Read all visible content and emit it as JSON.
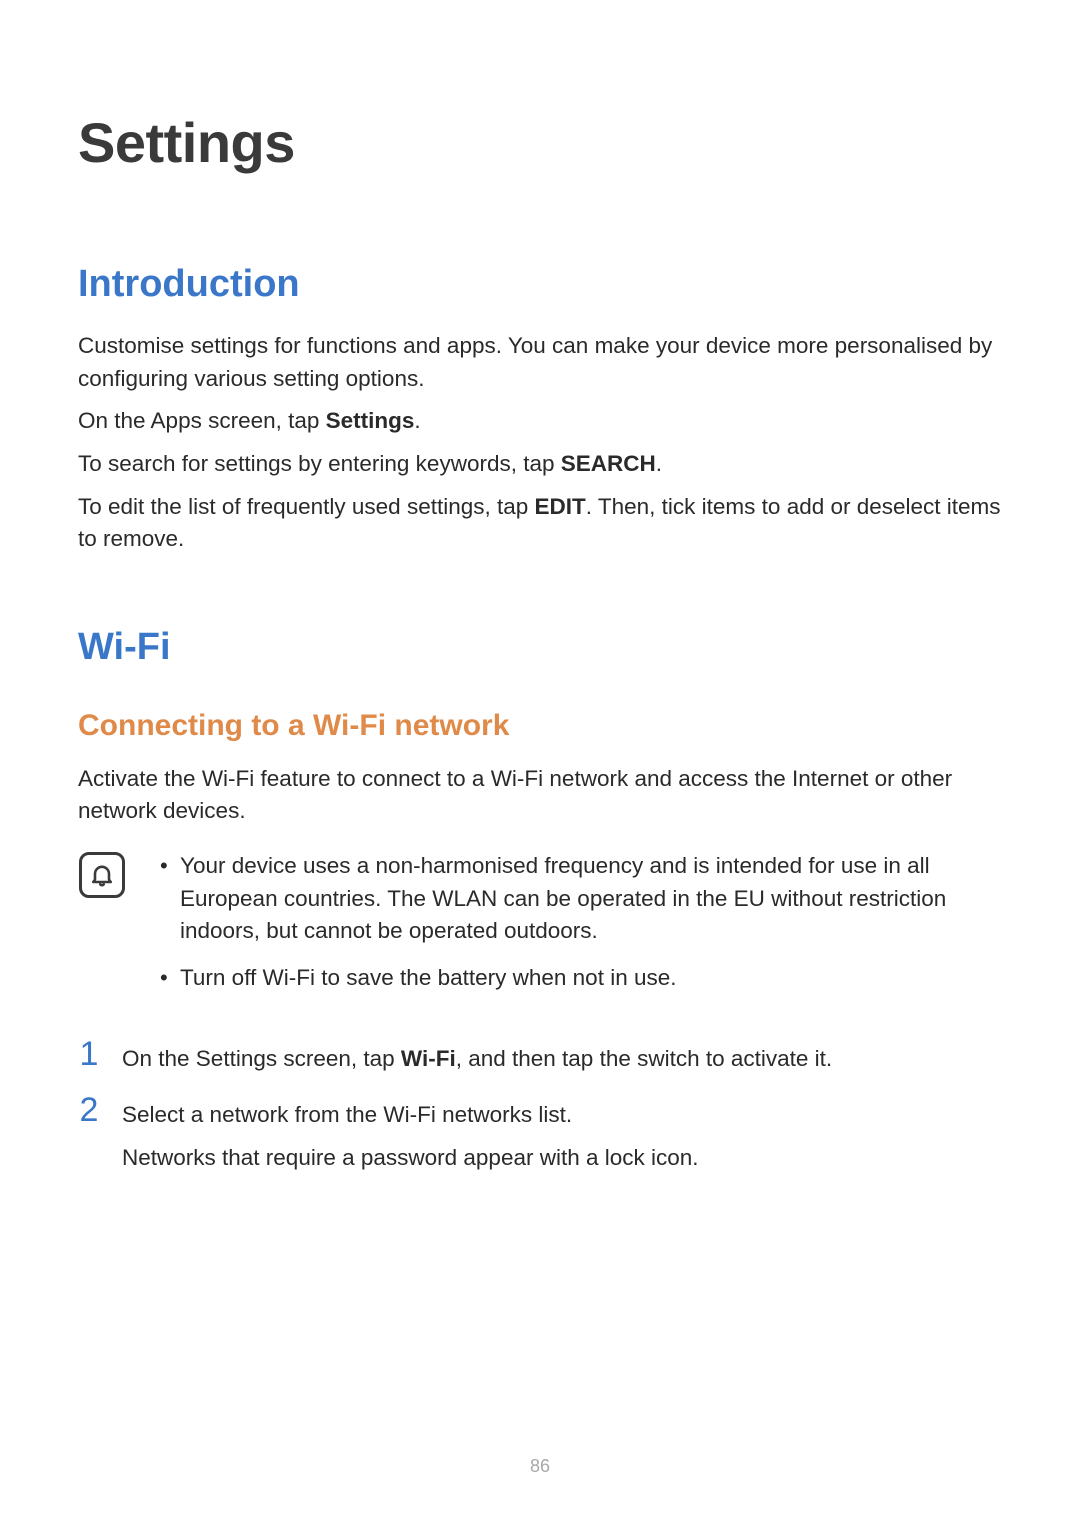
{
  "title": "Settings",
  "page_number": "86",
  "intro": {
    "heading": "Introduction",
    "p1": "Customise settings for functions and apps. You can make your device more personalised by configuring various setting options.",
    "p2_pre": "On the Apps screen, tap ",
    "p2_bold": "Settings",
    "p2_post": ".",
    "p3_pre": "To search for settings by entering keywords, tap ",
    "p3_bold": "SEARCH",
    "p3_post": ".",
    "p4_pre": "To edit the list of frequently used settings, tap ",
    "p4_bold": "EDIT",
    "p4_post": ". Then, tick items to add or deselect items to remove."
  },
  "wifi": {
    "heading": "Wi-Fi",
    "sub_heading": "Connecting to a Wi-Fi network",
    "p1": "Activate the Wi-Fi feature to connect to a Wi-Fi network and access the Internet or other network devices.",
    "notes": [
      "Your device uses a non-harmonised frequency and is intended for use in all European countries. The WLAN can be operated in the EU without restriction indoors, but cannot be operated outdoors.",
      "Turn off Wi-Fi to save the battery when not in use."
    ],
    "steps": {
      "s1_num": "1",
      "s1_pre": "On the Settings screen, tap ",
      "s1_bold": "Wi-Fi",
      "s1_post": ", and then tap the switch to activate it.",
      "s2_num": "2",
      "s2_main": "Select a network from the Wi-Fi networks list.",
      "s2_sub": "Networks that require a password appear with a lock icon."
    }
  }
}
